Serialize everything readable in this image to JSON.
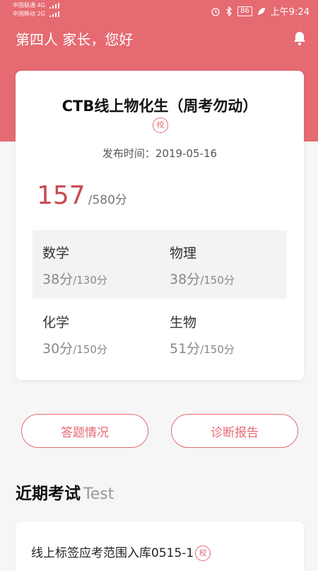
{
  "status": {
    "carrier1": "中国联通",
    "carrier1_net": "4G",
    "carrier2": "中国移动",
    "carrier2_net": "2G",
    "battery": "86",
    "time": "上午9:24"
  },
  "header": {
    "greeting": "第四人 家长，您好"
  },
  "exam": {
    "title": "CTB线上物化生（周考勿动）",
    "school_tag": "校",
    "publish_label": "发布时间：",
    "publish_date": "2019-05-16",
    "score": "157",
    "total": "/580分",
    "subjects": [
      {
        "name": "数学",
        "score": "38分",
        "total": "/130分"
      },
      {
        "name": "物理",
        "score": "38分",
        "total": "/150分"
      },
      {
        "name": "化学",
        "score": "30分",
        "total": "/150分"
      },
      {
        "name": "生物",
        "score": "51分",
        "total": "/150分"
      }
    ]
  },
  "actions": {
    "answers": "答题情况",
    "report": "诊断报告"
  },
  "recent": {
    "title": "近期考试",
    "title_en": "Test",
    "items": [
      {
        "title": "线上标签应考范围入库0515-1",
        "tag": "校"
      }
    ]
  },
  "colors": {
    "accent": "#e66a72",
    "score": "#c94b53"
  }
}
